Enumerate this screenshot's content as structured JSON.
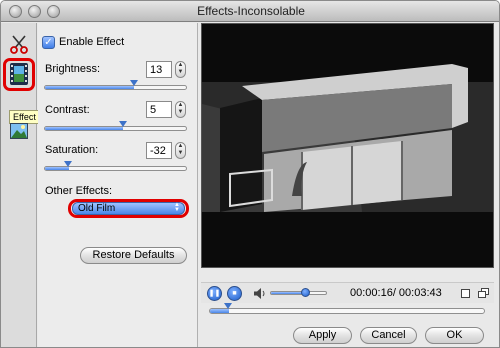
{
  "window": {
    "title": "Effects-Inconsolable"
  },
  "toolbar": {
    "tools": [
      {
        "name": "trim-tool",
        "icon": "scissors-icon"
      },
      {
        "name": "effect-tool",
        "icon": "film-strip-icon",
        "selected": true
      },
      {
        "name": "image-tool",
        "icon": "picture-icon"
      }
    ],
    "tooltip": "Effect"
  },
  "panel": {
    "enable_effect_label": "Enable Effect",
    "enable_effect_checked": true,
    "brightness": {
      "label": "Brightness:",
      "value": "13",
      "level": 0.63
    },
    "contrast": {
      "label": "Contrast:",
      "value": "5",
      "level": 0.55
    },
    "saturation": {
      "label": "Saturation:",
      "value": "-32",
      "level": 0.17
    },
    "other_effects_label": "Other Effects:",
    "other_effects_selected": "Old Film",
    "restore_defaults_label": "Restore Defaults"
  },
  "player": {
    "time_display": "00:00:16/ 00:03:43",
    "volume_level": 0.62,
    "progress": 0.07
  },
  "buttons": {
    "apply": "Apply",
    "cancel": "Cancel",
    "ok": "OK"
  },
  "colors": {
    "accent_blue": "#4a86e8",
    "highlight_red": "#e00000"
  }
}
